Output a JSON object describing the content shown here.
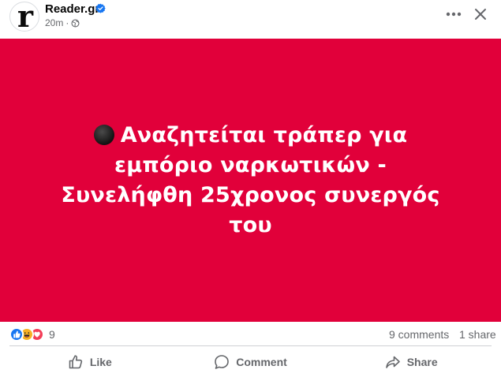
{
  "post": {
    "page_name": "Reader.gr",
    "avatar_letter": "r",
    "time": "20m",
    "separator": "·",
    "audience_icon": "globe-icon",
    "verified_icon": "verified-badge-icon",
    "headline": "Αναζητείται τράπερ για εμπόριο ναρκωτικών - Συνελήφθη 25χρονος συνεργός του",
    "headline_emoji": "black-circle-icon",
    "image_background": "#e1003a"
  },
  "header_actions": {
    "more_icon": "more-options-icon",
    "close_icon": "close-icon"
  },
  "stats": {
    "reaction_icons": [
      "like-reaction-icon",
      "haha-reaction-icon",
      "love-reaction-icon"
    ],
    "reaction_count": "9",
    "comments": "9 comments",
    "shares": "1 share"
  },
  "actions": {
    "like": "Like",
    "comment": "Comment",
    "share": "Share"
  },
  "colors": {
    "brand_blue": "#1877f2",
    "secondary_text": "#65676b",
    "love_red": "#f33e58",
    "haha_yellow": "#f7b125"
  }
}
